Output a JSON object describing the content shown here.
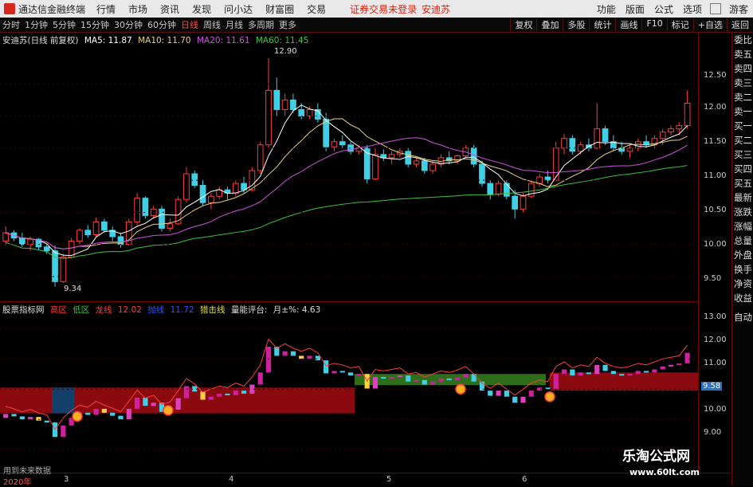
{
  "titlebar": {
    "app": "通达信金融终端",
    "menus": [
      "行情",
      "市场",
      "资讯",
      "发现",
      "问小达",
      "财富圈",
      "交易"
    ],
    "login_notice": "证券交易未登录",
    "stock_name": "安迪苏",
    "right_items": [
      "功能",
      "版面",
      "公式",
      "选项",
      "游客"
    ]
  },
  "toolbar": {
    "timeframes": [
      "分时",
      "1分钟",
      "5分钟",
      "15分钟",
      "30分钟",
      "60分钟",
      "日线",
      "周线",
      "月线",
      "多周期",
      "更多"
    ],
    "active": "日线",
    "right_buttons": [
      "复权",
      "叠加",
      "多股",
      "统计",
      "画线",
      "F10",
      "标记",
      "+自选",
      "返回"
    ]
  },
  "main_info": {
    "title": "安迪苏(日线 前复权)",
    "ma5": "MA5: 11.87",
    "ma10": "MA10: 11.70",
    "ma20": "MA20: 11.61",
    "ma60": "MA60: 11.45",
    "high_label": "12.90",
    "low_label": "9.34"
  },
  "sub_info": {
    "title": "股票指标网",
    "high_zone": "高区",
    "low_zone": "低区",
    "dragon_line": "龙线",
    "dragon_val": "12.02",
    "mid_line": "抛线",
    "mid_val": "11.72",
    "hunt_line": "猎击线",
    "rating": "量能评台:",
    "month_pct": "月±%: 4.63",
    "marker": "9.58"
  },
  "axis_main": [
    "12.50",
    "12.00",
    "11.50",
    "11.00",
    "10.50",
    "10.00",
    "9.50"
  ],
  "axis_sub": [
    "13.00",
    "12.00",
    "11.00",
    "10.00",
    "9.00"
  ],
  "right_sidebar": [
    "委比",
    "卖五",
    "卖四",
    "卖三",
    "卖二",
    "卖一",
    "买一",
    "买二",
    "买三",
    "买四",
    "买五",
    "最新",
    "涨跌",
    "涨幅",
    "总量",
    "外盘",
    "换手",
    "净资",
    "收益",
    "自动"
  ],
  "bottom_axis": [
    "2020年",
    "3",
    "4",
    "5",
    "6"
  ],
  "hint": "用到未来数据",
  "watermark": {
    "cn": "乐淘公式网",
    "url": "www.60lt.com"
  },
  "colors": {
    "up": "#ff3b3b",
    "down": "#3fd0e6",
    "ma5": "#ffffff",
    "ma10": "#e8d280",
    "ma20": "#d050e0",
    "ma60": "#40c040"
  },
  "candles": [
    [
      10.05,
      10.28,
      9.98,
      10.18
    ],
    [
      10.18,
      10.22,
      10.05,
      10.1
    ],
    [
      10.1,
      10.18,
      9.96,
      10.0
    ],
    [
      10.0,
      10.12,
      9.9,
      10.08
    ],
    [
      10.08,
      10.1,
      9.92,
      9.96
    ],
    [
      9.96,
      10.0,
      9.85,
      9.9
    ],
    [
      9.9,
      9.98,
      9.34,
      9.42
    ],
    [
      9.42,
      9.85,
      9.4,
      9.8
    ],
    [
      9.8,
      10.1,
      9.78,
      10.05
    ],
    [
      10.05,
      10.25,
      10.0,
      10.22
    ],
    [
      10.22,
      10.3,
      10.1,
      10.15
    ],
    [
      10.15,
      10.42,
      10.12,
      10.35
    ],
    [
      10.35,
      10.4,
      10.18,
      10.22
    ],
    [
      10.22,
      10.28,
      10.05,
      10.12
    ],
    [
      10.12,
      10.18,
      9.95,
      10.0
    ],
    [
      10.0,
      10.4,
      9.98,
      10.35
    ],
    [
      10.35,
      10.8,
      10.3,
      10.72
    ],
    [
      10.72,
      10.75,
      10.4,
      10.45
    ],
    [
      10.45,
      10.6,
      10.4,
      10.55
    ],
    [
      10.55,
      10.6,
      10.2,
      10.25
    ],
    [
      10.25,
      10.4,
      10.2,
      10.32
    ],
    [
      10.32,
      10.75,
      10.3,
      10.7
    ],
    [
      10.7,
      11.2,
      10.65,
      11.1
    ],
    [
      11.1,
      11.15,
      10.88,
      10.92
    ],
    [
      10.92,
      11.0,
      10.6,
      10.65
    ],
    [
      10.65,
      10.8,
      10.55,
      10.75
    ],
    [
      10.75,
      10.9,
      10.7,
      10.85
    ],
    [
      10.85,
      10.9,
      10.7,
      10.8
    ],
    [
      10.8,
      11.0,
      10.75,
      10.95
    ],
    [
      10.95,
      11.05,
      10.8,
      10.85
    ],
    [
      10.85,
      11.2,
      10.82,
      11.15
    ],
    [
      11.15,
      11.6,
      11.1,
      11.55
    ],
    [
      11.55,
      12.9,
      11.5,
      12.4
    ],
    [
      12.4,
      12.6,
      12.0,
      12.1
    ],
    [
      12.1,
      12.35,
      12.0,
      12.25
    ],
    [
      12.25,
      12.35,
      12.05,
      12.1
    ],
    [
      12.1,
      12.2,
      11.95,
      12.0
    ],
    [
      12.0,
      12.15,
      11.95,
      12.1
    ],
    [
      12.1,
      12.2,
      11.9,
      11.95
    ],
    [
      11.95,
      12.05,
      11.45,
      11.52
    ],
    [
      11.52,
      11.65,
      11.45,
      11.6
    ],
    [
      11.6,
      11.7,
      11.5,
      11.55
    ],
    [
      11.55,
      11.6,
      11.4,
      11.45
    ],
    [
      11.45,
      11.55,
      11.4,
      11.5
    ],
    [
      11.5,
      11.55,
      10.95,
      11.02
    ],
    [
      11.02,
      11.5,
      11.0,
      11.4
    ],
    [
      11.4,
      11.48,
      11.3,
      11.35
    ],
    [
      11.35,
      11.45,
      11.25,
      11.4
    ],
    [
      11.4,
      11.5,
      11.35,
      11.45
    ],
    [
      11.45,
      11.5,
      11.2,
      11.25
    ],
    [
      11.25,
      11.35,
      11.2,
      11.3
    ],
    [
      11.3,
      11.35,
      11.1,
      11.15
    ],
    [
      11.15,
      11.3,
      11.1,
      11.25
    ],
    [
      11.25,
      11.4,
      11.2,
      11.35
    ],
    [
      11.35,
      11.45,
      11.25,
      11.3
    ],
    [
      11.3,
      11.4,
      11.25,
      11.38
    ],
    [
      11.38,
      11.55,
      11.35,
      11.5
    ],
    [
      11.5,
      11.55,
      11.2,
      11.25
    ],
    [
      11.25,
      11.3,
      10.9,
      10.95
    ],
    [
      10.95,
      11.0,
      10.7,
      10.78
    ],
    [
      10.78,
      11.0,
      10.75,
      10.95
    ],
    [
      10.95,
      11.0,
      10.7,
      10.75
    ],
    [
      10.75,
      10.85,
      10.4,
      10.55
    ],
    [
      10.55,
      10.8,
      10.5,
      10.75
    ],
    [
      10.75,
      11.0,
      10.72,
      10.95
    ],
    [
      10.95,
      11.1,
      10.9,
      11.05
    ],
    [
      11.05,
      11.15,
      10.95,
      11.0
    ],
    [
      11.0,
      11.6,
      10.98,
      11.5
    ],
    [
      11.5,
      11.72,
      11.4,
      11.65
    ],
    [
      11.65,
      11.7,
      11.4,
      11.45
    ],
    [
      11.45,
      11.6,
      11.4,
      11.55
    ],
    [
      11.55,
      11.65,
      11.45,
      11.5
    ],
    [
      11.5,
      12.2,
      11.48,
      11.8
    ],
    [
      11.8,
      11.85,
      11.55,
      11.6
    ],
    [
      11.6,
      11.7,
      11.45,
      11.5
    ],
    [
      11.5,
      11.6,
      11.4,
      11.45
    ],
    [
      11.45,
      11.55,
      11.35,
      11.5
    ],
    [
      11.5,
      11.65,
      11.45,
      11.6
    ],
    [
      11.6,
      11.7,
      11.5,
      11.55
    ],
    [
      11.55,
      11.7,
      11.5,
      11.65
    ],
    [
      11.65,
      11.8,
      11.55,
      11.75
    ],
    [
      11.75,
      11.85,
      11.7,
      11.8
    ],
    [
      11.8,
      11.9,
      11.7,
      11.85
    ],
    [
      11.85,
      12.4,
      11.8,
      12.2
    ]
  ]
}
